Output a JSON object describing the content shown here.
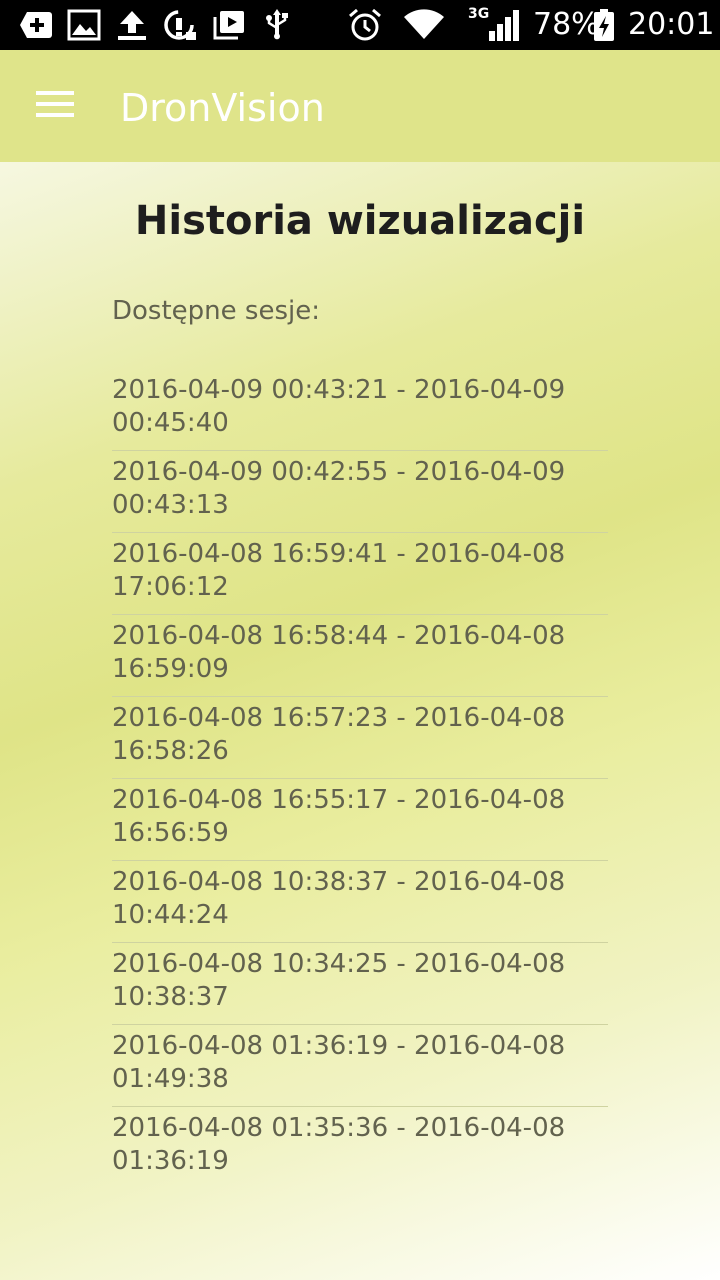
{
  "status_bar": {
    "icons": [
      "add-box-icon",
      "image-icon",
      "upload-icon",
      "sync-icon",
      "video-library-icon",
      "usb-icon",
      "alarm-icon",
      "wifi-icon",
      "signal-3g-icon",
      "battery-charging-icon"
    ],
    "network": "3G",
    "battery": "78%",
    "time": "20:01"
  },
  "app_bar": {
    "menu_icon": "hamburger-menu-icon",
    "title": "DronVision",
    "color": "#dfe48a"
  },
  "main": {
    "title": "Historia wizualizacji",
    "sessions_label": "Dostępne sesje:",
    "sessions": [
      {
        "start": "2016-04-09 00:43:21 - 2016-04-09",
        "end": "00:45:40"
      },
      {
        "start": "2016-04-09 00:42:55 - 2016-04-09",
        "end": "00:43:13"
      },
      {
        "start": "2016-04-08 16:59:41 - 2016-04-08",
        "end": "17:06:12"
      },
      {
        "start": "2016-04-08 16:58:44 - 2016-04-08",
        "end": "16:59:09"
      },
      {
        "start": "2016-04-08 16:57:23 - 2016-04-08",
        "end": "16:58:26"
      },
      {
        "start": "2016-04-08 16:55:17 - 2016-04-08",
        "end": "16:56:59"
      },
      {
        "start": "2016-04-08 10:38:37 - 2016-04-08",
        "end": "10:44:24"
      },
      {
        "start": "2016-04-08 10:34:25 - 2016-04-08",
        "end": "10:38:37"
      },
      {
        "start": "2016-04-08 01:36:19 - 2016-04-08",
        "end": "01:49:38"
      },
      {
        "start": "2016-04-08 01:35:36 - 2016-04-08",
        "end": "01:36:19"
      }
    ]
  }
}
